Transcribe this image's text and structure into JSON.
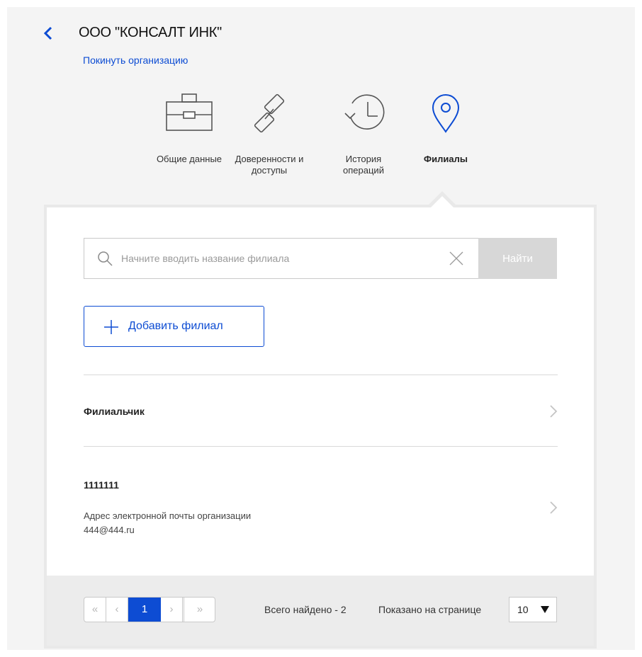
{
  "header": {
    "org_title": "ООО \"КОНСАЛТ ИНК\"",
    "leave_link": "Покинуть организацию"
  },
  "tabs": [
    {
      "label": "Общие данные",
      "icon": "briefcase-icon",
      "active": false
    },
    {
      "label": "Доверенности и доступы",
      "icon": "link-icon",
      "active": false
    },
    {
      "label": "История операций",
      "icon": "history-icon",
      "active": false
    },
    {
      "label": "Филиалы",
      "icon": "location-pin-icon",
      "active": true
    }
  ],
  "search": {
    "placeholder": "Начните вводить название филиала",
    "value": "",
    "button_label": "Найти"
  },
  "add_button": {
    "label": "Добавить филиал"
  },
  "branches": [
    {
      "name": "Филиальчик"
    },
    {
      "name": "1111111",
      "email_label": "Адрес электронной почты организации",
      "email": "444@444.ru"
    }
  ],
  "pagination": {
    "first": "«",
    "prev": "‹",
    "current_page": "1",
    "next": "›",
    "last": "»",
    "total_text": "Всего найдено - 2",
    "per_page_label": "Показано на странице",
    "per_page_value": "10"
  },
  "colors": {
    "accent": "#0d4cd3",
    "background": "#f4f4f4",
    "disabled_button": "#d7d7d7"
  }
}
